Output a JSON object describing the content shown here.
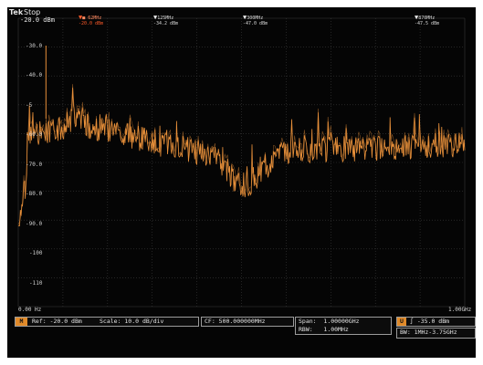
{
  "header": {
    "brand": "Tek",
    "run_status": "Stop",
    "ref_level_label": "-20.0 dBm",
    "trigger_label": "T"
  },
  "markers": [
    {
      "freq": "■ 62MHz",
      "value": "-20.0 dBm",
      "is_ref": true
    },
    {
      "freq": "125MHz",
      "value": "-34.2 dBm",
      "is_ref": false
    },
    {
      "freq": "300MHz",
      "value": "-47.0 dBm",
      "is_ref": false
    },
    {
      "freq": "870MHz",
      "value": "-47.5 dBm",
      "is_ref": false
    }
  ],
  "axis": {
    "y_labels": [
      "-20.0",
      "-30.0",
      "-40.0",
      "-5",
      "-60.0",
      "-70.0",
      "-80.0",
      "-90.0",
      "-100",
      "-110",
      "-120"
    ],
    "x_start": "0.00 Hz",
    "x_end": "1.00GHz"
  },
  "readouts": {
    "ref_badge": "M",
    "ref_text": "Ref: -20.0 dBm",
    "scale_text": "Scale: 10.0 dB/div",
    "cf_text": "CF: 500.000000MHz",
    "span_label": "Span:",
    "span_value": "1.00000GHz",
    "rbw_label": "RBW:",
    "rbw_value": "1.00MHz",
    "trig_badge": "U",
    "trig_text": "∫ -35.0 dBm",
    "bw_text": "BW: 1MHz-3.75GHz"
  },
  "colors": {
    "trace": "#e8903a",
    "grid": "#3a3a3a",
    "background": "#050505",
    "accent": "#e08a2a"
  }
}
